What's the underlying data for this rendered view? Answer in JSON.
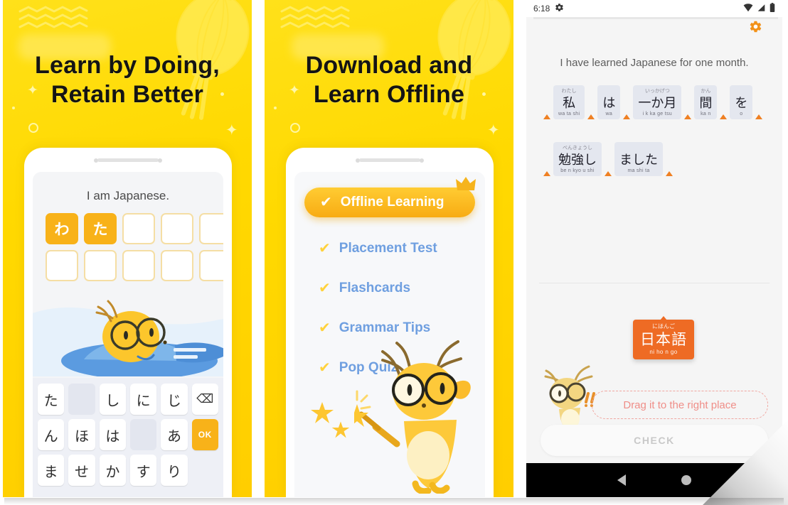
{
  "panels": [
    {
      "id": "learn-by-doing",
      "title_line1": "Learn by Doing,",
      "title_line2": "Retain Better",
      "prompt": "I am Japanese.",
      "answer_cells": [
        {
          "text": "わ",
          "filled": true
        },
        {
          "text": "た",
          "filled": true
        },
        {
          "text": "",
          "filled": false
        },
        {
          "text": "",
          "filled": false
        },
        {
          "text": "",
          "filled": false
        },
        {
          "text": "",
          "filled": false
        },
        {
          "text": "",
          "filled": false
        },
        {
          "text": "",
          "filled": false
        },
        {
          "text": "",
          "filled": false
        },
        {
          "text": "",
          "filled": false
        }
      ],
      "keyboard": {
        "rows": [
          [
            {
              "label": "た",
              "type": "char"
            },
            {
              "label": "",
              "type": "blank"
            },
            {
              "label": "し",
              "type": "char"
            },
            {
              "label": "に",
              "type": "char"
            },
            {
              "label": "じ",
              "type": "char"
            },
            {
              "label": "⌫",
              "type": "backspace"
            }
          ],
          [
            {
              "label": "ん",
              "type": "char"
            },
            {
              "label": "ほ",
              "type": "char"
            },
            {
              "label": "は",
              "type": "char"
            },
            {
              "label": "",
              "type": "blank"
            },
            {
              "label": "あ",
              "type": "char"
            },
            {
              "label": "OK",
              "type": "ok"
            }
          ],
          [
            {
              "label": "ま",
              "type": "char"
            },
            {
              "label": "せ",
              "type": "char"
            },
            {
              "label": "か",
              "type": "char"
            },
            {
              "label": "す",
              "type": "char"
            },
            {
              "label": "り",
              "type": "char"
            },
            {
              "label": "",
              "type": "ghost"
            }
          ]
        ]
      }
    },
    {
      "id": "download-and-learn-offline",
      "title_line1": "Download and",
      "title_line2": "Learn Offline",
      "features": [
        {
          "label": "Offline Learning",
          "highlighted": true,
          "crown": true
        },
        {
          "label": "Placement Test",
          "highlighted": false,
          "crown": false
        },
        {
          "label": "Flashcards",
          "highlighted": false,
          "crown": false
        },
        {
          "label": "Grammar Tips",
          "highlighted": false,
          "crown": false
        },
        {
          "label": "Pop Quiz",
          "highlighted": false,
          "crown": false
        }
      ],
      "check_glyph": "✔"
    },
    {
      "id": "android-exercise-screen",
      "statusbar": {
        "time": "6:18",
        "gear_icon": "gear-icon",
        "wifi_icon": "wifi-icon",
        "signal_icon": "signal-icon",
        "battery_icon": "battery-icon"
      },
      "settings_icon": "settings-gear-icon",
      "sentence": "I have learned Japanese for one month.",
      "answer_rows": [
        [
          {
            "furigana": "わたし",
            "kanji": "私",
            "romaji": "wa ta shi"
          },
          {
            "furigana": "",
            "kanji": "は",
            "romaji": "wa"
          },
          {
            "furigana": "いっかげつ",
            "kanji": "一か月",
            "romaji": "i k ka ge tsu"
          },
          {
            "furigana": "かん",
            "kanji": "間",
            "romaji": "ka n"
          },
          {
            "furigana": "",
            "kanji": "を",
            "romaji": "o"
          }
        ],
        [
          {
            "furigana": "べんきょうし",
            "kanji": "勉強し",
            "romaji": "be n kyo u shi"
          },
          {
            "furigana": "",
            "kanji": "ました",
            "romaji": "ma shi ta"
          }
        ]
      ],
      "drag_card": {
        "furigana": "にほんご",
        "kanji": "日本語",
        "romaji": "ni ho n go"
      },
      "drop_hint": "Drag it to the right place",
      "check_button": "CHECK",
      "navbar": {
        "back_icon": "back-triangle-icon",
        "home_icon": "home-circle-icon"
      }
    }
  ],
  "colors": {
    "promo_yellow": "#ffd900",
    "accent_orange": "#f8b219",
    "drag_card_orange": "#ee6b24",
    "feature_blue": "#6f9fe0",
    "check_yellow": "#ffd23c",
    "hint_pink": "#ef8e88"
  }
}
